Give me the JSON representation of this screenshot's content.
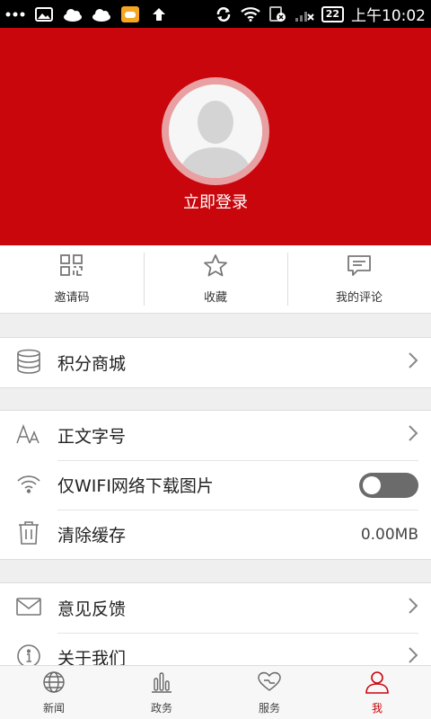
{
  "status_bar": {
    "battery": "22",
    "time": "上午10:02"
  },
  "profile": {
    "login_label": "立即登录"
  },
  "quick_actions": [
    {
      "label": "邀请码",
      "icon": "qr-code-icon"
    },
    {
      "label": "收藏",
      "icon": "star-icon"
    },
    {
      "label": "我的评论",
      "icon": "comment-icon"
    }
  ],
  "group1": [
    {
      "label": "积分商城",
      "icon": "database-icon"
    }
  ],
  "group2": [
    {
      "label": "正文字号",
      "icon": "font-size-icon"
    },
    {
      "label": "仅WIFI网络下载图片",
      "icon": "wifi-icon",
      "toggle": "off"
    },
    {
      "label": "清除缓存",
      "icon": "trash-icon",
      "value": "0.00MB"
    }
  ],
  "group3": [
    {
      "label": "意见反馈",
      "icon": "mail-icon"
    },
    {
      "label": "关于我们",
      "icon": "info-icon"
    }
  ],
  "bottom_nav": [
    {
      "label": "新闻",
      "icon": "globe-icon"
    },
    {
      "label": "政务",
      "icon": "bar-chart-icon"
    },
    {
      "label": "服务",
      "icon": "heart-hands-icon"
    },
    {
      "label": "我",
      "icon": "user-icon",
      "active": true
    }
  ],
  "colors": {
    "brand_red": "#c8060c",
    "toggle_off": "#6b6b6b"
  }
}
